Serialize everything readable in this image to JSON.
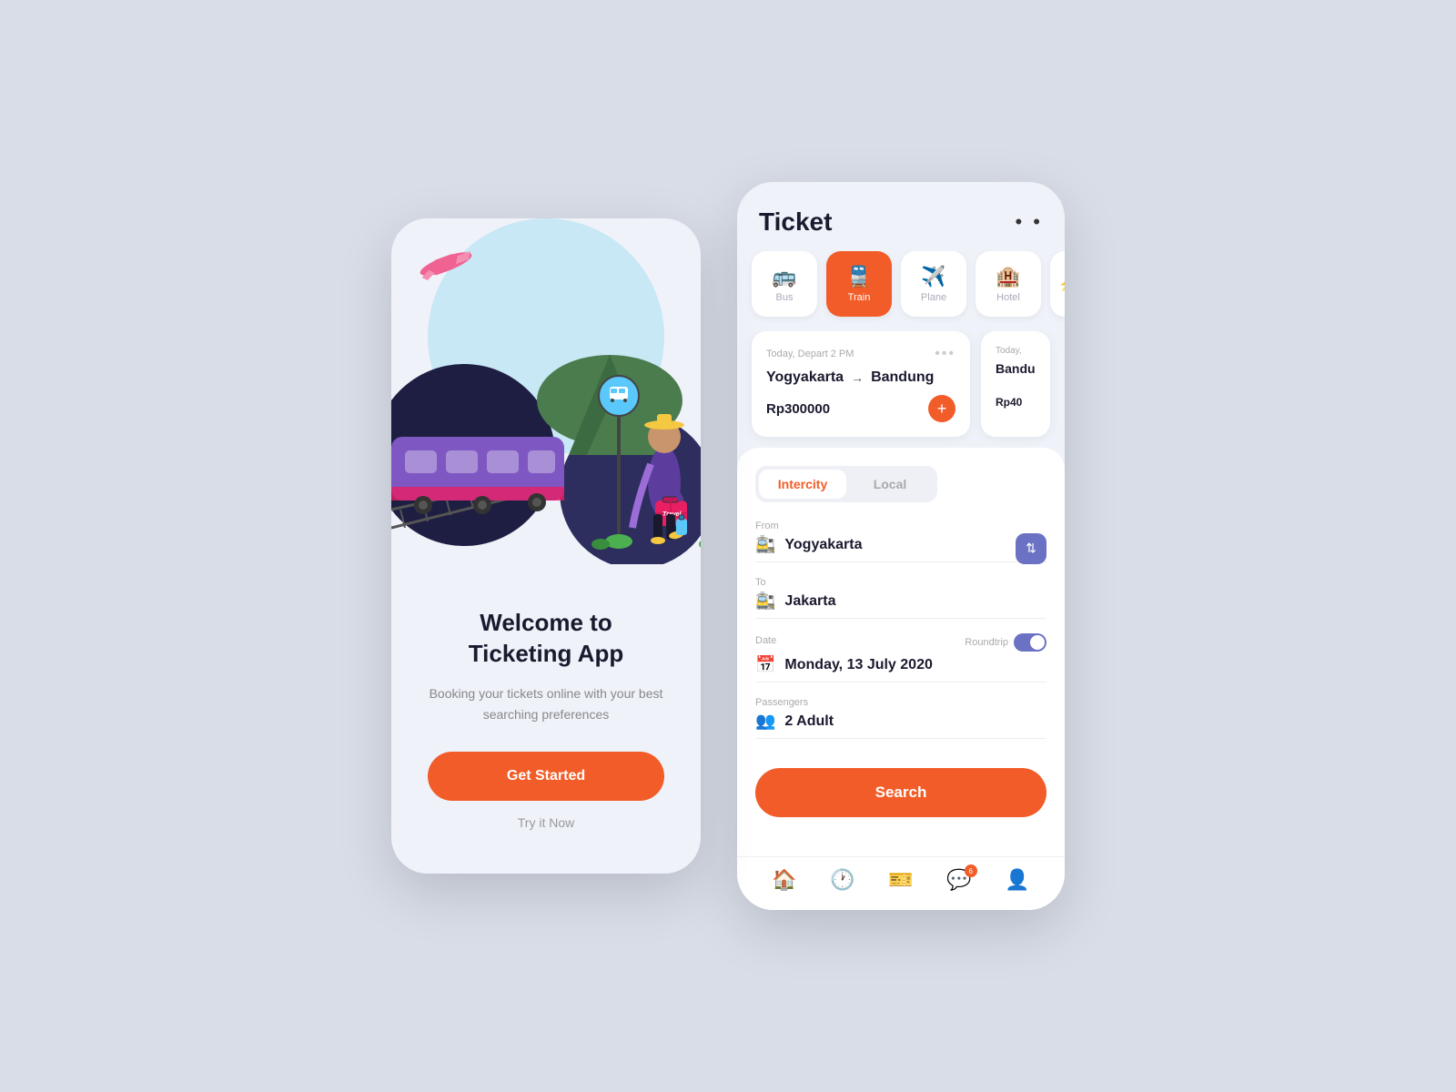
{
  "welcome": {
    "title": "Welcome to\nTicketing App",
    "subtitle": "Booking your tickets online with your best searching preferences",
    "get_started_label": "Get Started",
    "try_now_label": "Try it Now"
  },
  "ticket": {
    "header_title": "Ticket",
    "header_dots": "• •",
    "categories": [
      {
        "id": "bus",
        "icon": "🚌",
        "label": "Bus",
        "active": false
      },
      {
        "id": "train",
        "icon": "🚆",
        "label": "Train",
        "active": true
      },
      {
        "id": "plane",
        "icon": "✈️",
        "label": "Plane",
        "active": false
      },
      {
        "id": "hotel",
        "icon": "🏨",
        "label": "Hotel",
        "active": false
      }
    ],
    "recent_tickets": [
      {
        "date": "Today, Depart 2 PM",
        "from": "Yogyakarta",
        "to": "Bandung",
        "price": "Rp300000"
      },
      {
        "date": "Today,",
        "from": "Bandu",
        "to": "",
        "price": "Rp40"
      }
    ],
    "tabs": [
      "Intercity",
      "Local"
    ],
    "active_tab": "Intercity",
    "form": {
      "from_label": "From",
      "from_value": "Yogyakarta",
      "to_label": "To",
      "to_value": "Jakarta",
      "date_label": "Date",
      "date_value": "Monday, 13 July 2020",
      "roundtrip_label": "Roundtrip",
      "passengers_label": "Passengers",
      "passengers_value": "2 Adult"
    },
    "search_label": "Search",
    "nav_items": [
      "home",
      "history",
      "ticket",
      "chat",
      "profile"
    ]
  }
}
